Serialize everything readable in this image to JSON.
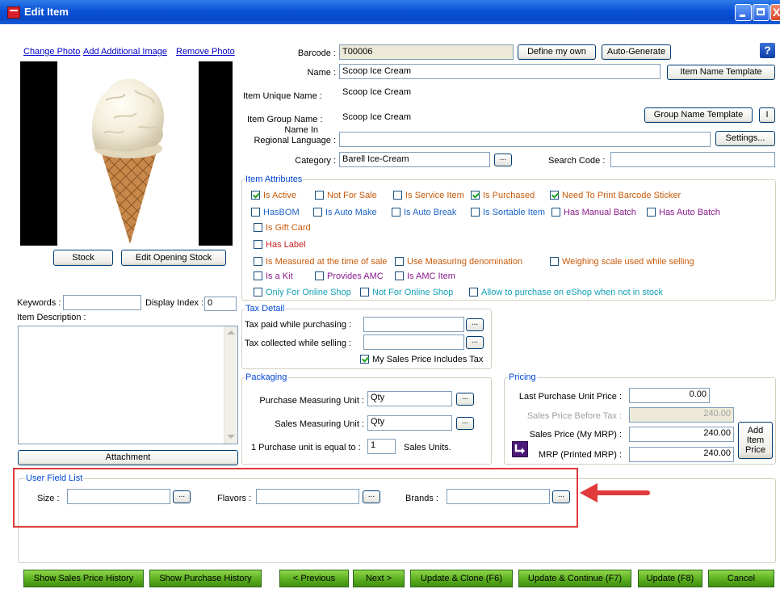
{
  "window": {
    "title": "Edit Item"
  },
  "help_label": "?",
  "photo": {
    "change": "Change Photo",
    "add": "Add Additional Image",
    "remove": "Remove Photo"
  },
  "stock_label": "Stock",
  "edit_opening_stock_label": "Edit Opening Stock",
  "keywords_label": "Keywords :",
  "keywords_value": "",
  "display_index_label": "Display Index :",
  "display_index_value": "0",
  "item_description_label": "Item Description :",
  "attachment_label": "Attachment",
  "barcode": {
    "label": "Barcode :",
    "value": "T00006",
    "define_label": "Define my own",
    "auto_label": "Auto-Generate"
  },
  "name": {
    "label": "Name :",
    "value": "Scoop Ice Cream",
    "template_label": "Item Name Template"
  },
  "unique_name": {
    "label": "Item Unique Name :",
    "value": "Scoop Ice Cream"
  },
  "group_name": {
    "label": "Item Group Name :",
    "value": "Scoop Ice Cream",
    "template_label": "Group Name Template",
    "extra_label": "I"
  },
  "regional": {
    "label_line1": "Name In",
    "label_line2": "Regional Language :",
    "value": "",
    "settings_label": "Settings..."
  },
  "category": {
    "label": "Category :",
    "value": "Barell Ice-Cream",
    "dots": "..."
  },
  "search_code": {
    "label": "Search Code :",
    "value": ""
  },
  "attributes": {
    "title": "Item Attributes",
    "items": [
      {
        "label": "Is Active",
        "checked": true
      },
      {
        "label": "Not For Sale",
        "checked": false
      },
      {
        "label": "Is Service Item",
        "checked": false
      },
      {
        "label": "Is Purchased",
        "checked": true
      },
      {
        "label": "Need To Print Barcode Sticker",
        "checked": true
      },
      {
        "label": "HasBOM",
        "checked": false
      },
      {
        "label": "Is Auto Make",
        "checked": false
      },
      {
        "label": "Is Auto Break",
        "checked": false
      },
      {
        "label": "Is Sortable Item",
        "checked": false
      },
      {
        "label": "Has Manual Batch",
        "checked": false
      },
      {
        "label": "Has Auto Batch",
        "checked": false
      },
      {
        "label": "Is Gift Card",
        "checked": false
      },
      {
        "label": "Has Label",
        "checked": false
      },
      {
        "label": "Is Measured at the time of sale",
        "checked": false
      },
      {
        "label": "Use Measuring denomination",
        "checked": false
      },
      {
        "label": "Weighing scale used while selling",
        "checked": false
      },
      {
        "label": "Is a Kit",
        "checked": false
      },
      {
        "label": "Provides AMC",
        "checked": false
      },
      {
        "label": "Is AMC Item",
        "checked": false
      },
      {
        "label": "Only For Online Shop",
        "checked": false
      },
      {
        "label": "Not For Online Shop",
        "checked": false
      },
      {
        "label": "Allow to purchase on eShop when not in stock",
        "checked": false
      }
    ]
  },
  "tax": {
    "title": "Tax Detail",
    "paid_label": "Tax paid while purchasing :",
    "paid_value": "",
    "collected_label": "Tax collected while selling :",
    "collected_value": "",
    "includes_label": "My Sales Price Includes Tax",
    "includes_checked": true
  },
  "packaging": {
    "title": "Packaging",
    "purchase_label": "Purchase Measuring Unit :",
    "purchase_value": "Qty",
    "sales_label": "Sales Measuring Unit :",
    "sales_value": "Qty",
    "equal_label": "1  Purchase unit is equal to :",
    "equal_value": "1",
    "sales_units_label": "Sales Units."
  },
  "pricing": {
    "title": "Pricing",
    "last_purchase_label": "Last Purchase  Unit Price :",
    "last_purchase_value": "0.00",
    "before_tax_label": "Sales Price Before Tax :",
    "before_tax_value": "240.00",
    "my_mrp_label": "Sales Price (My MRP) :",
    "my_mrp_value": "240.00",
    "printed_mrp_label": "MRP (Printed MRP) :",
    "printed_mrp_value": "240.00",
    "add_price_line1": "Add",
    "add_price_line2": "Item",
    "add_price_line3": "Price"
  },
  "user_fields": {
    "title": "User Field List",
    "size_label": "Size :",
    "size_value": "",
    "flavors_label": "Flavors :",
    "flavors_value": "",
    "brands_label": "Brands :",
    "brands_value": ""
  },
  "footer": {
    "sales_history": "Show Sales Price History",
    "purchase_history": "Show Purchase History",
    "previous": "< Previous",
    "next": "Next >",
    "update_clone": "Update & Clone  (F6)",
    "update_continue": "Update & Continue (F7)",
    "update": "Update (F8)",
    "cancel": "Cancel"
  },
  "colors": {
    "highlight_box": "#e03a3a",
    "arrow": "#e03a3a",
    "group_title": "#0046d5"
  }
}
